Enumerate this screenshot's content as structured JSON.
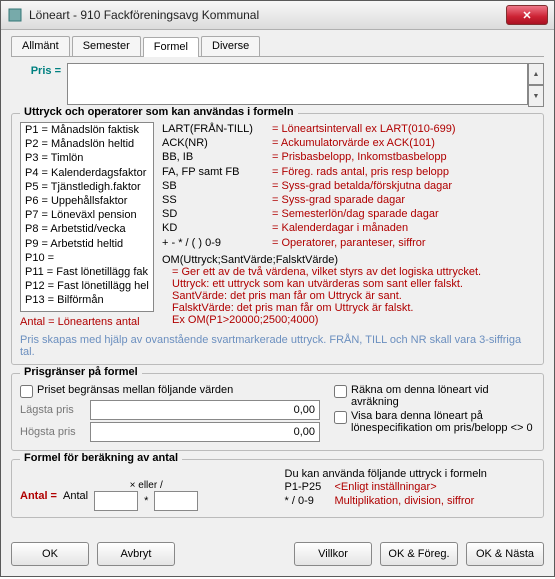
{
  "window": {
    "title": "Löneart - 910  Fackföreningsavg Kommunal",
    "close_glyph": "✕"
  },
  "tabs": {
    "items": [
      {
        "label": "Allmänt"
      },
      {
        "label": "Semester"
      },
      {
        "label": "Formel"
      },
      {
        "label": "Diverse"
      }
    ],
    "active_index": 2
  },
  "pris": {
    "label": "Pris  =",
    "value": ""
  },
  "expr_group": {
    "title": "Uttryck och operatorer som kan användas i formeln",
    "list_items": [
      "P1  = Månadslön faktisk",
      "P2  = Månadslön heltid",
      "P3  = Timlön",
      "P4  = Kalenderdagsfaktor",
      "P5  = Tjänstledigh.faktor",
      "P6  = Uppehållsfaktor",
      "P7  = Löneväxl pension",
      "P8  = Arbetstid/vecka",
      "P9  = Arbetstid heltid",
      "P10 =",
      "P11 = Fast lönetillägg fak",
      "P12 = Fast lönetillägg hel",
      "P13 = Bilförmån"
    ],
    "antal_note_left": "Antal",
    "antal_note_right": " = Löneartens antal",
    "ops": [
      {
        "l": "LART(FRÅN-TILL)",
        "r": "= Löneartsintervall   ex LART(010-699)"
      },
      {
        "l": "ACK(NR)",
        "r": "= Ackumulatorvärde   ex ACK(101)"
      },
      {
        "l": "BB, IB",
        "r": "= Prisbasbelopp, Inkomstbasbelopp"
      },
      {
        "l": "FA, FP samt FB",
        "r": "= Föreg. rads antal, pris resp belopp"
      },
      {
        "l": "SB",
        "r": "= Syss-grad betalda/förskjutna dagar"
      },
      {
        "l": "SS",
        "r": "= Syss-grad sparade dagar"
      },
      {
        "l": "SD",
        "r": "= Semesterlön/dag sparade dagar"
      },
      {
        "l": "KD",
        "r": "= Kalenderdagar i månaden"
      },
      {
        "l": "+ - * /  ( )  0-9",
        "r": "= Operatorer, paranteser, siffror"
      }
    ],
    "om_header": "OM(Uttryck;SantVärde;FalsktVärde)",
    "om_lines": [
      "= Ger ett av de två värdena, vilket styrs av det logiska uttrycket.",
      "Uttryck: ett uttryck som kan utvärderas som sant eller falskt.",
      "SantVärde: det pris man får om Uttryck är sant.",
      "FalsktVärde: det pris man får om Uttryck är falskt.",
      "Ex OM(P1>20000;2500;4000)"
    ],
    "hint": "Pris skapas med hjälp av ovanstående svartmarkerade uttryck. FRÅN, TILL och NR skall vara 3-siffriga tal."
  },
  "limits_group": {
    "title": "Prisgränser på formel",
    "chk_between": "Priset begränsas mellan följande värden",
    "lowest_label": "Lägsta pris",
    "lowest_value": "0,00",
    "highest_label": "Högsta pris",
    "highest_value": "0,00",
    "chk_rakna": "Räkna om denna löneart vid avräkning",
    "chk_visa": "Visa bara denna löneart på lönespecifikation om pris/belopp <> 0"
  },
  "antal_group": {
    "title": "Formel för beräkning av antal",
    "antal_eq": "Antal  =",
    "antal_word": "Antal",
    "x_eller": "× eller /",
    "val1": "",
    "val2": "",
    "right_intro": "Du kan använda följande uttryck i formeln",
    "p_range": "P1-P25",
    "p_range_note": "<Enligt inställningar>",
    "ops_left": "* / 0-9",
    "ops_note": "Multiplikation, division, siffror"
  },
  "buttons": {
    "ok": "OK",
    "avbryt": "Avbryt",
    "villkor": "Villkor",
    "ok_prev": "OK & Föreg.",
    "ok_next": "OK & Nästa"
  }
}
